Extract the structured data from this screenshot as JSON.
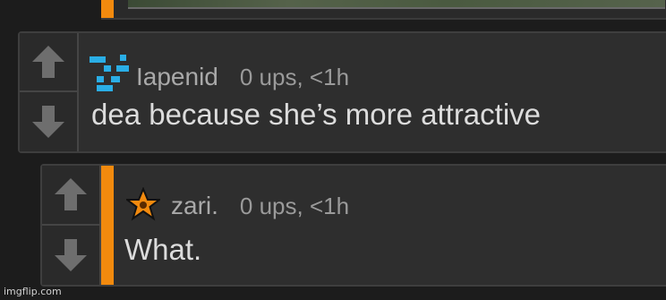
{
  "colors": {
    "accent": "#f28a0e",
    "background": "#1c1c1c",
    "panel": "#2e2e2e"
  },
  "comments": [
    {
      "username": "Iapenid",
      "stats": "0 ups, <1h",
      "body": "dea because she’s more attractive",
      "avatar_icon": "pixel-logo-icon"
    },
    {
      "username": "zari.",
      "stats": "0 ups, <1h",
      "body": "What.",
      "avatar_icon": "star-badge-icon"
    }
  ],
  "watermark": "imgflip.com"
}
